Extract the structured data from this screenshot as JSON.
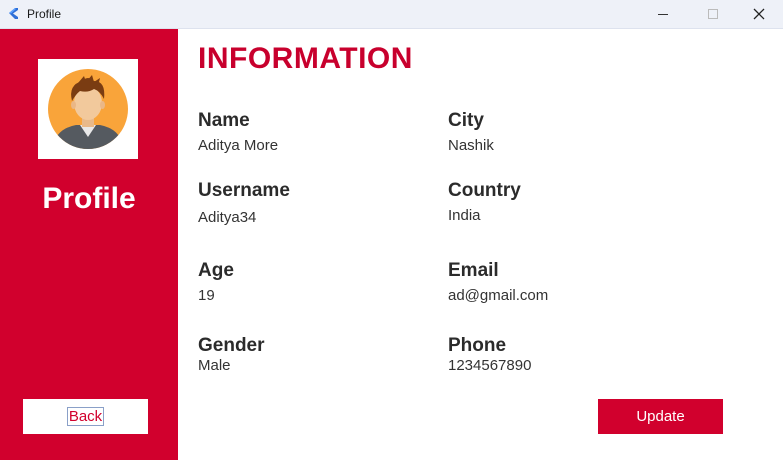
{
  "window": {
    "title": "Profile",
    "minimize_icon": "minimize-icon",
    "maximize_icon": "maximize-icon",
    "close_icon": "close-icon"
  },
  "sidebar": {
    "title": "Profile",
    "avatar_icon": "user-avatar-icon",
    "back_label": "Back",
    "background_color": "#d1002d"
  },
  "main": {
    "heading": "INFORMATION",
    "fields": {
      "name": {
        "label": "Name",
        "value": "Aditya More"
      },
      "city": {
        "label": "City",
        "value": "Nashik"
      },
      "username": {
        "label": "Username",
        "value": "Aditya34"
      },
      "country": {
        "label": "Country",
        "value": "India"
      },
      "age": {
        "label": "Age",
        "value": "19"
      },
      "email": {
        "label": "Email",
        "value": "ad@gmail.com"
      },
      "gender": {
        "label": "Gender",
        "value": "Male"
      },
      "phone": {
        "label": "Phone",
        "value": "1234567890"
      }
    },
    "update_label": "Update"
  },
  "colors": {
    "accent": "#d1002d",
    "heading": "#c8002d",
    "text": "#2b2b2b"
  }
}
